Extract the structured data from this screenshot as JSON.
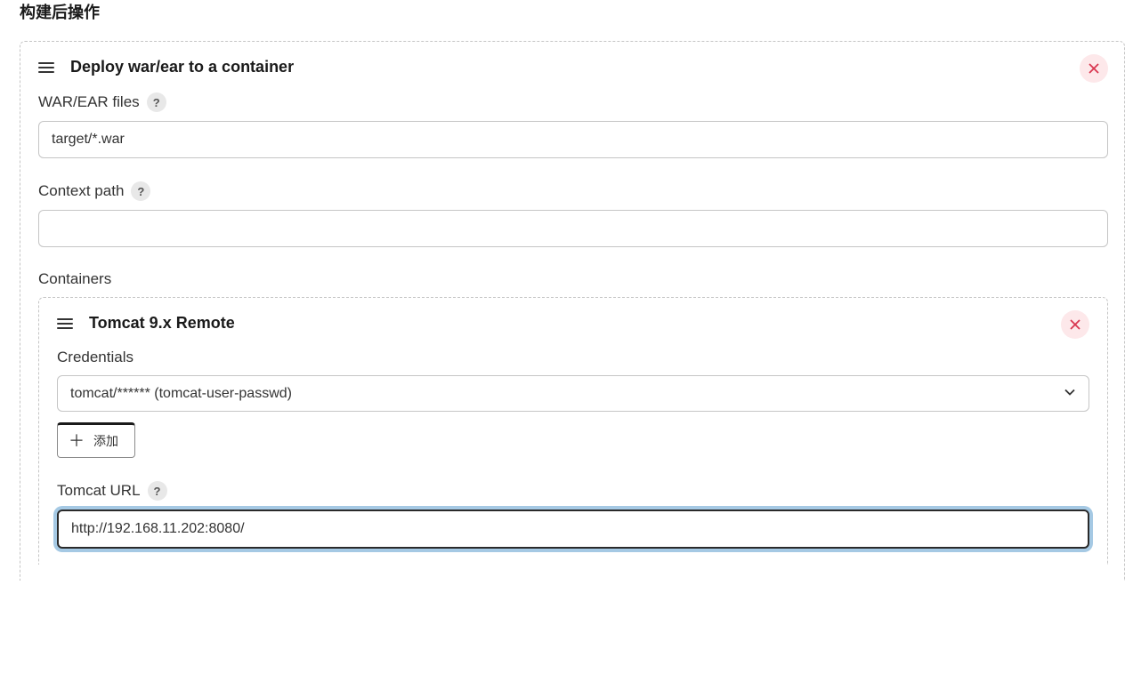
{
  "section": {
    "title": "构建后操作"
  },
  "deploy_block": {
    "title": "Deploy war/ear to a container",
    "fields": {
      "war_ear_label": "WAR/EAR files",
      "war_ear_value": "target/*.war",
      "context_path_label": "Context path",
      "context_path_value": "",
      "containers_label": "Containers"
    }
  },
  "container_block": {
    "title": "Tomcat 9.x Remote",
    "credentials_label": "Credentials",
    "credentials_value": "tomcat/****** (tomcat-user-passwd)",
    "add_button_label": "添加",
    "tomcat_url_label": "Tomcat URL",
    "tomcat_url_value": "http://192.168.11.202:8080/"
  },
  "icons": {
    "help": "?",
    "plus": "＋"
  }
}
